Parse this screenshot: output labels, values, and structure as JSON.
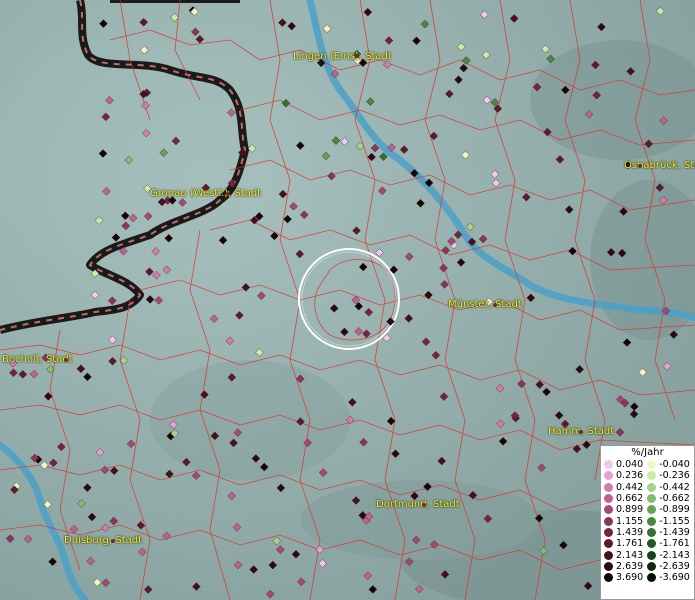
{
  "cities": [
    {
      "name": "Lingen (Ems), Stadt"
    },
    {
      "name": "Osnabrück, Stadt"
    },
    {
      "name": "Gronau (Westf.), Stadt"
    },
    {
      "name": "Münster, Stadt"
    },
    {
      "name": "Bocholt, Stadt"
    },
    {
      "name": "Hamm, Stadt"
    },
    {
      "name": "Dortmund, Stadt"
    },
    {
      "name": "Duisburg, Stadt"
    }
  ],
  "legend": {
    "unit": "%/Jahr",
    "positive": [
      {
        "label": "0.040",
        "color": "#f4c6ef"
      },
      {
        "label": "0.236",
        "color": "#e8a0d4"
      },
      {
        "label": "0.442",
        "color": "#d47aae"
      },
      {
        "label": "0.662",
        "color": "#c0608e"
      },
      {
        "label": "0.899",
        "color": "#a84870"
      },
      {
        "label": "1.155",
        "color": "#8e3456"
      },
      {
        "label": "1.439",
        "color": "#76243e"
      },
      {
        "label": "1.761",
        "color": "#5e1a2c"
      },
      {
        "label": "2.143",
        "color": "#46101c"
      },
      {
        "label": "2.639",
        "color": "#2e0810"
      },
      {
        "label": "3.690",
        "color": "#180306"
      }
    ],
    "negative": [
      {
        "label": "-0.040",
        "color": "#eef7c4"
      },
      {
        "label": "-0.236",
        "color": "#cde9a6"
      },
      {
        "label": "-0.442",
        "color": "#a9d388"
      },
      {
        "label": "-0.662",
        "color": "#84bc6c"
      },
      {
        "label": "-0.899",
        "color": "#62a352"
      },
      {
        "label": "-1.155",
        "color": "#458a3e"
      },
      {
        "label": "-1.439",
        "color": "#30722e"
      },
      {
        "label": "-1.761",
        "color": "#1f5a20"
      },
      {
        "label": "-2.143",
        "color": "#134316"
      },
      {
        "label": "-2.639",
        "color": "#0a2c0d"
      },
      {
        "label": "-3.690",
        "color": "#031605"
      }
    ]
  },
  "colors": {
    "land": "#8fa9a6",
    "border": "#e0302a",
    "river": "#4aa0c8",
    "national_border": "#1a1a1a",
    "label": "#f2f21a"
  }
}
